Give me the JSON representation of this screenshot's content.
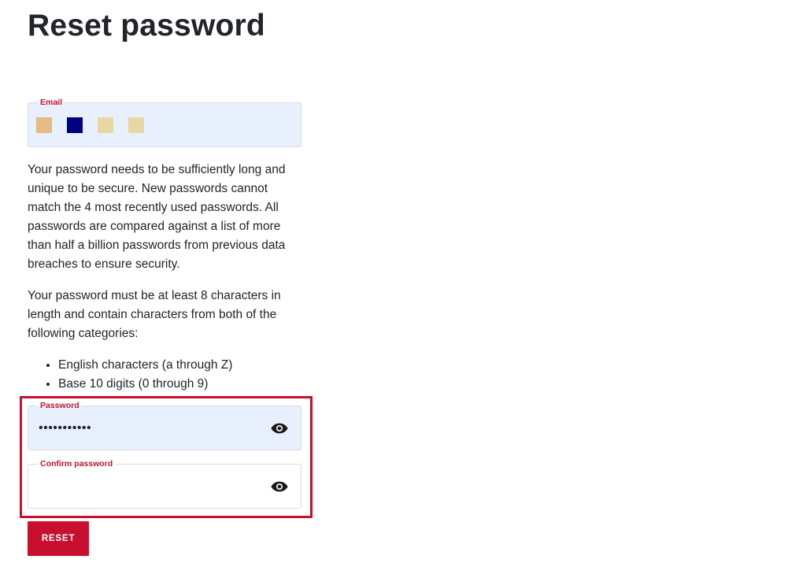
{
  "page": {
    "title": "Reset password"
  },
  "email": {
    "label": "Email",
    "swatch_colors": [
      "#e4bc82",
      "#020080",
      "#ead6a0",
      "#ead6a0"
    ]
  },
  "description": {
    "paragraph1": "Your password needs to be sufficiently long and unique to be secure. New passwords cannot match the 4 most recently used passwords. All passwords are compared against a list of more than half a billion passwords from previous data breaches to ensure security.",
    "paragraph2": "Your password must be at least 8 characters in length and contain characters from both of the following categories:",
    "rules": [
      "English characters (a through Z)",
      "Base 10 digits (0 through 9)"
    ]
  },
  "password": {
    "label": "Password",
    "value": "•••••••••••",
    "toggle_icon": "eye-icon"
  },
  "confirm_password": {
    "label": "Confirm password",
    "value": "",
    "toggle_icon": "eye-icon"
  },
  "actions": {
    "reset_label": "RESET"
  },
  "colors": {
    "accent": "#c8102e",
    "filled_input_bg": "#e8f0fd",
    "text": "#212529"
  }
}
